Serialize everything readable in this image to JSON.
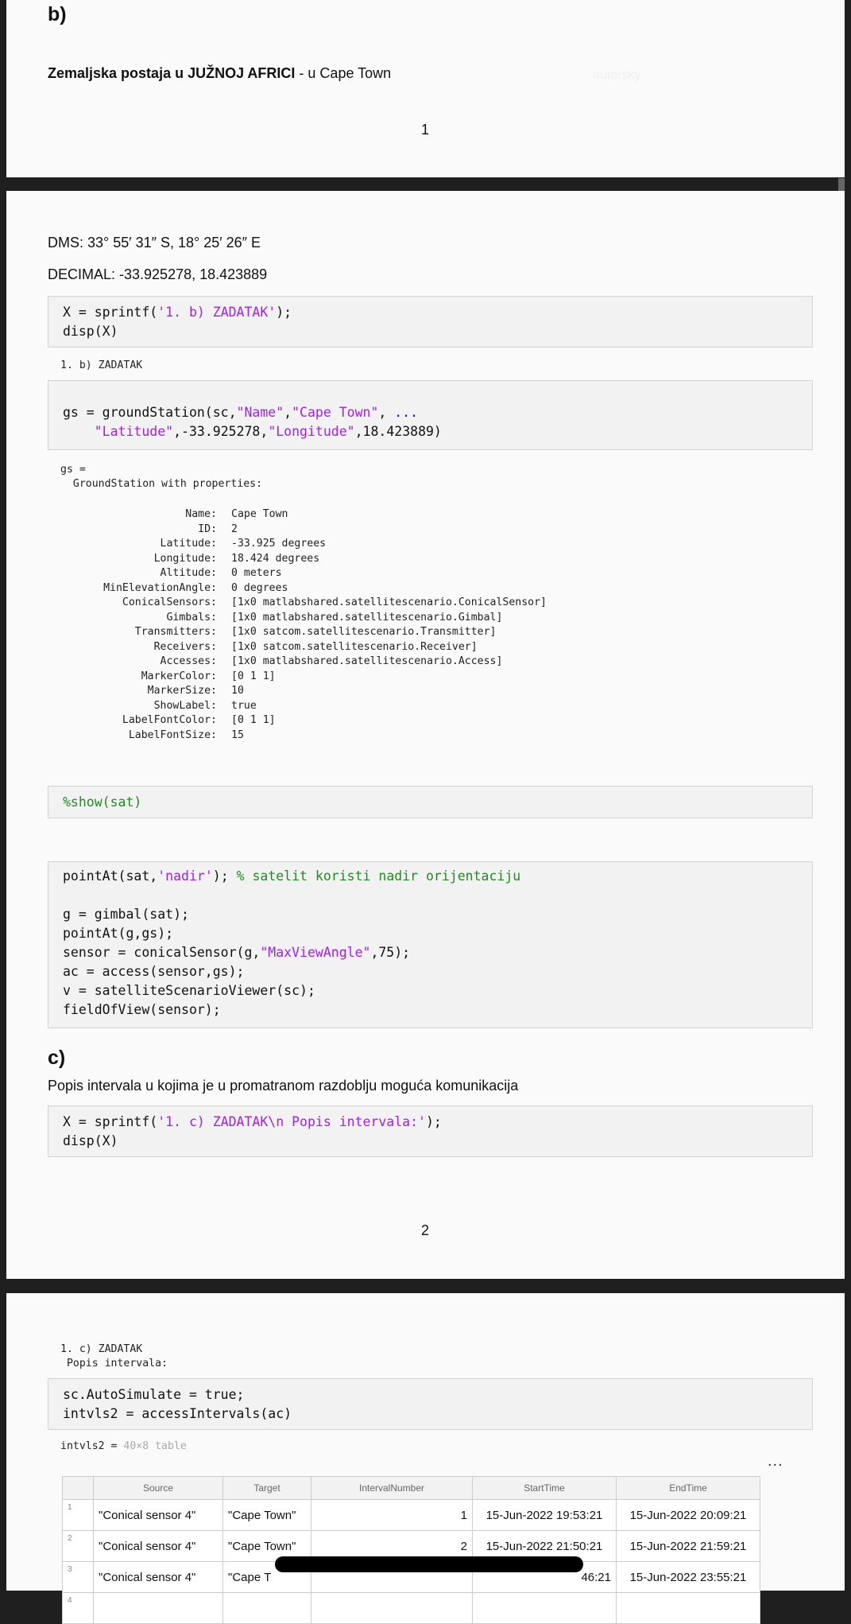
{
  "page1": {
    "section_label": "b)",
    "station_heading_bold": "Zemaljska postaja u JUŽNOJ AFRICI",
    "station_heading_rest": " - u Cape Town",
    "watermark": "autorsky",
    "page_number": "1"
  },
  "page2": {
    "dms": "DMS: 33° 55′ 31″ S, 18° 25′ 26″ E",
    "decimal": "DECIMAL:  -33.925278, 18.423889",
    "code1": {
      "l1a": "X = sprintf(",
      "l1b": "'1. b) ZADATAK'",
      "l1c": ");",
      "l2": "disp(X)"
    },
    "out1": "1. b) ZADATAK",
    "code2": {
      "l1a": "gs = groundStation(sc,",
      "l1b": "\"Name\"",
      "l1c": ",",
      "l1d": "\"Cape Town\"",
      "l1e": ", ",
      "l1f": "...",
      "l2a": "    ",
      "l2b": "\"Latitude\"",
      "l2c": ",-33.925278,",
      "l2d": "\"Longitude\"",
      "l2e": ",18.423889)"
    },
    "out2_head": "gs = ",
    "out2_sub": "  GroundStation with properties:",
    "properties": [
      {
        "k": "Name:",
        "v": "Cape Town"
      },
      {
        "k": "ID:",
        "v": "2"
      },
      {
        "k": "Latitude:",
        "v": "-33.925 degrees"
      },
      {
        "k": "Longitude:",
        "v": "18.424 degrees"
      },
      {
        "k": "Altitude:",
        "v": "0 meters"
      },
      {
        "k": "MinElevationAngle:",
        "v": "0 degrees"
      },
      {
        "k": "ConicalSensors:",
        "v": "[1x0 matlabshared.satellitescenario.ConicalSensor]"
      },
      {
        "k": "Gimbals:",
        "v": "[1x0 matlabshared.satellitescenario.Gimbal]"
      },
      {
        "k": "Transmitters:",
        "v": "[1x0 satcom.satellitescenario.Transmitter]"
      },
      {
        "k": "Receivers:",
        "v": "[1x0 satcom.satellitescenario.Receiver]"
      },
      {
        "k": "Accesses:",
        "v": "[1x0 matlabshared.satellitescenario.Access]"
      },
      {
        "k": "MarkerColor:",
        "v": "[0 1 1]"
      },
      {
        "k": "MarkerSize:",
        "v": "10"
      },
      {
        "k": "ShowLabel:",
        "v": "true"
      },
      {
        "k": "LabelFontColor:",
        "v": "[0 1 1]"
      },
      {
        "k": "LabelFontSize:",
        "v": "15"
      }
    ],
    "code3": "%show(sat)",
    "code4": {
      "l1a": "pointAt(sat,",
      "l1b": "'nadir'",
      "l1c": "); ",
      "l1d": "% satelit koristi nadir orijentaciju",
      "l3": "g = gimbal(sat);",
      "l4": "pointAt(g,gs);",
      "l5a": "sensor = conicalSensor(g,",
      "l5b": "\"MaxViewAngle\"",
      "l5c": ",75);",
      "l6": "ac = access(sensor,gs);",
      "l7": "v = satelliteScenarioViewer(sc);",
      "l8": "fieldOfView(sensor);"
    },
    "section_c": "c)",
    "section_c_text": "Popis intervala u kojima je u promatranom razdoblju moguća komunikacija",
    "code5": {
      "l1a": "X = sprintf(",
      "l1b": "'1. c) ZADATAK\\n Popis intervala:'",
      "l1c": ");",
      "l2": "disp(X)"
    },
    "page_number": "2"
  },
  "page3": {
    "out_l1": "1. c) ZADATAK",
    "out_l2": " Popis intervala:",
    "code6": {
      "l1": "sc.AutoSimulate = true;",
      "l2": "intvls2 = accessIntervals(ac)"
    },
    "table_label": "intvls2 = ",
    "table_dims": "40×8 table",
    "ellipsis": "...",
    "table": {
      "headers": [
        "",
        "Source",
        "Target",
        "IntervalNumber",
        "StartTime",
        "EndTime"
      ],
      "rows": [
        {
          "i": "1",
          "source": "\"Conical sensor 4\"",
          "target": "\"Cape Town\"",
          "num": "1",
          "start": "15-Jun-2022 19:53:21",
          "end": "15-Jun-2022 20:09:21"
        },
        {
          "i": "2",
          "source": "\"Conical sensor 4\"",
          "target": "\"Cape Town\"",
          "num": "2",
          "start": "15-Jun-2022 21:50:21",
          "end": "15-Jun-2022 21:59:21"
        },
        {
          "i": "3",
          "source": "\"Conical sensor 4\"",
          "target": "\"Cape T",
          "num": "",
          "start": "46:21",
          "end": "15-Jun-2022 23:55:21"
        },
        {
          "i": "4",
          "source": "",
          "target": "",
          "num": "",
          "start": "",
          "end": ""
        }
      ]
    }
  }
}
